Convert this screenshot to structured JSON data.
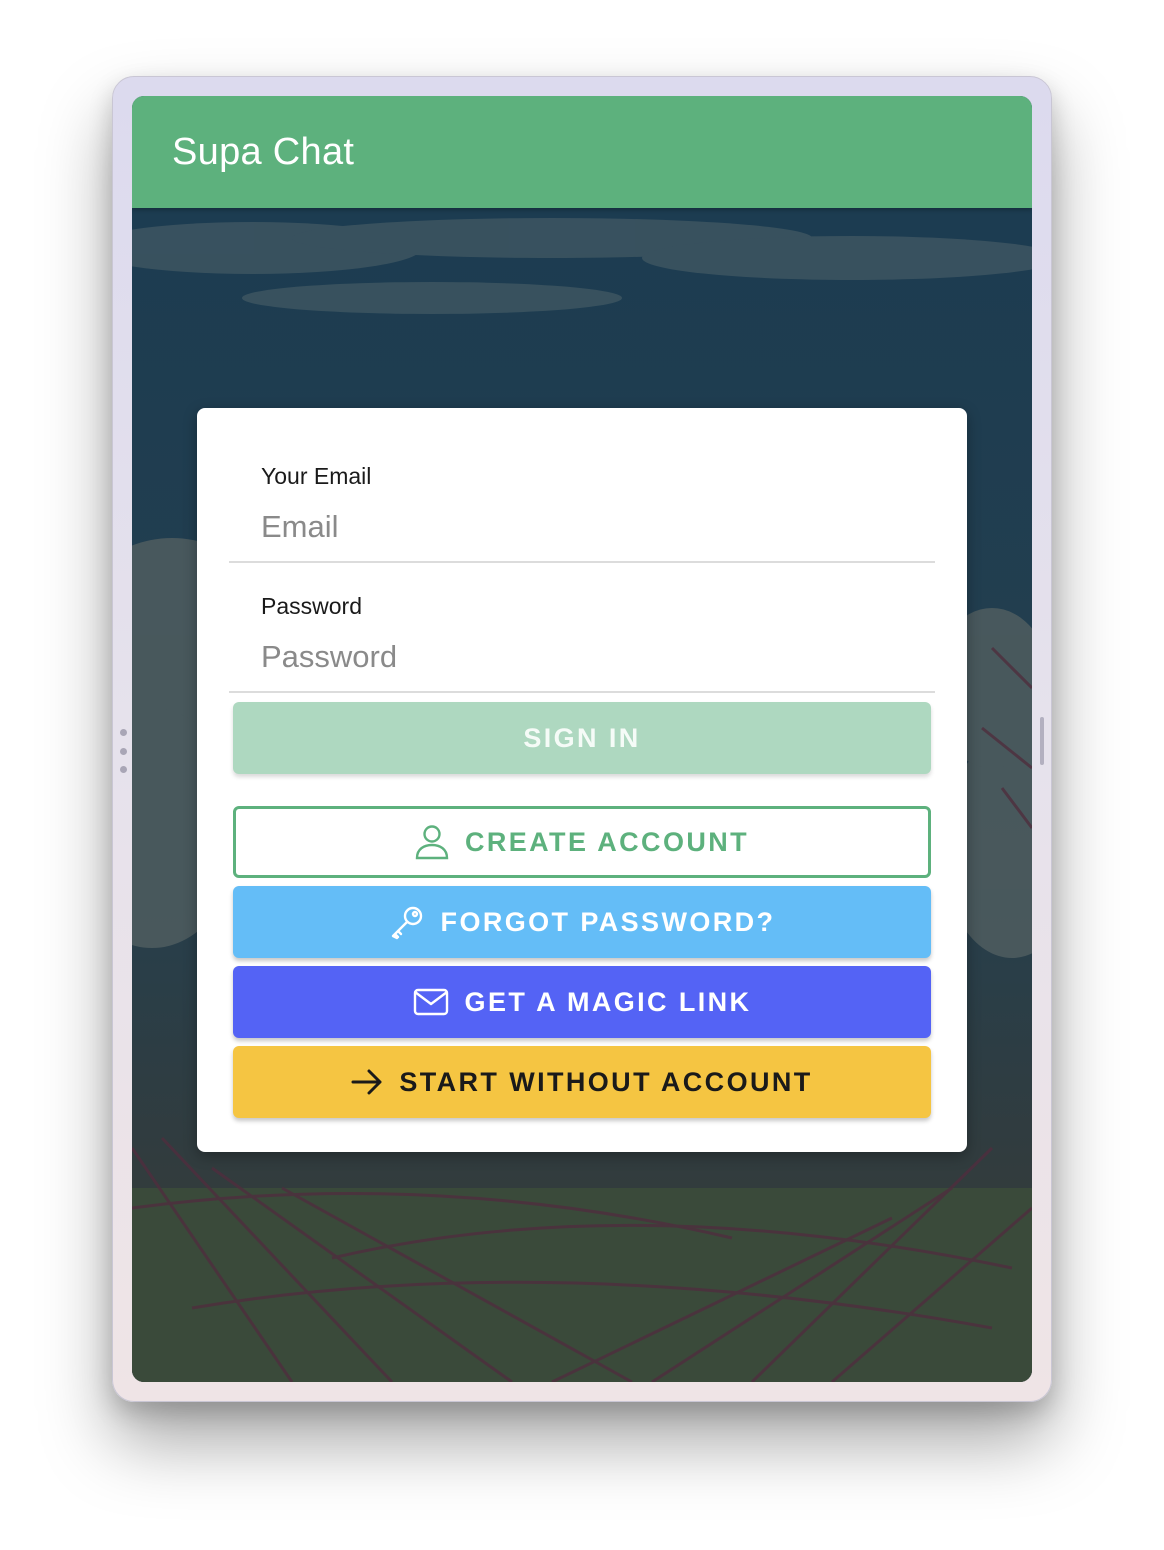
{
  "app": {
    "title": "Supa Chat"
  },
  "form": {
    "email": {
      "label": "Your Email",
      "placeholder": "Email",
      "value": ""
    },
    "password": {
      "label": "Password",
      "placeholder": "Password",
      "value": ""
    }
  },
  "buttons": {
    "sign_in": "SIGN IN",
    "create_account": {
      "label": "CREATE ACCOUNT",
      "icon": "user-icon"
    },
    "forgot_password": {
      "label": "FORGOT PASSWORD?",
      "icon": "key-icon"
    },
    "magic_link": {
      "label": "GET A MAGIC LINK",
      "icon": "mail-icon"
    },
    "start_without_account": {
      "label": "START WITHOUT ACCOUNT",
      "icon": "arrow-right-icon"
    }
  },
  "colors": {
    "primary": "#5db17d",
    "sign_in_disabled": "#aed8c0",
    "forgot": "#64bdf7",
    "magic": "#5463f5",
    "start": "#f5c542"
  }
}
